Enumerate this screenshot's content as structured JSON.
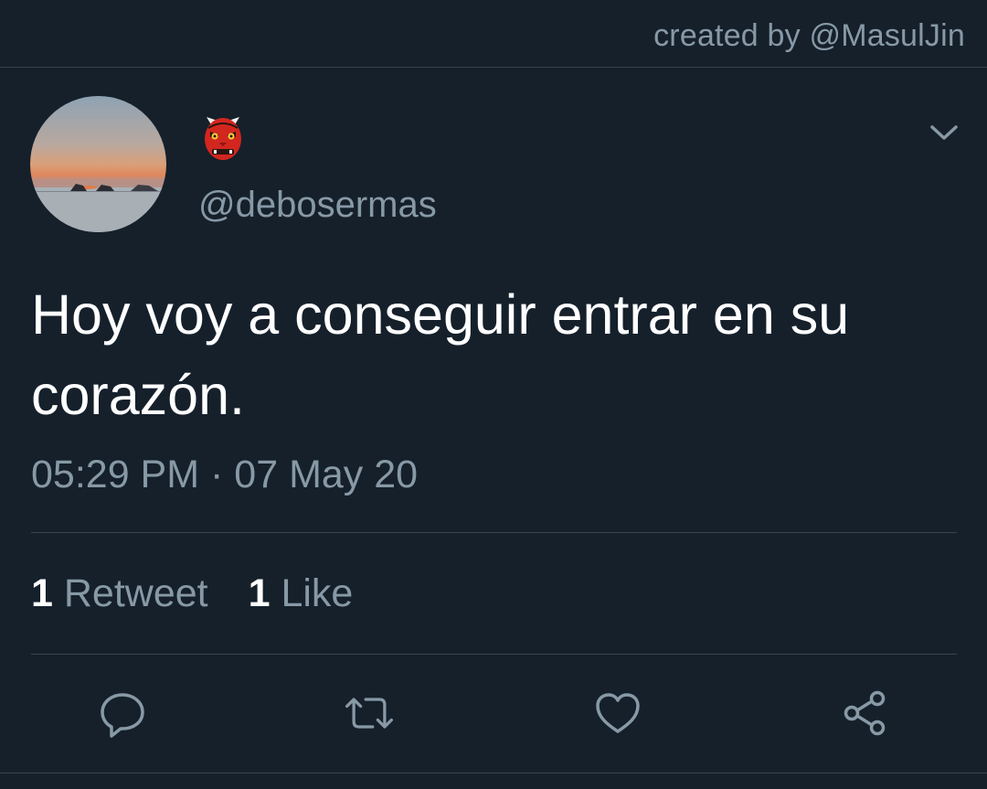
{
  "header": {
    "credit": "created by @MasulJin"
  },
  "tweet": {
    "display_name_icon": "red-oni-mask-emoji",
    "handle": "@debosermas",
    "text": "Hoy voy a conseguir entrar en su corazón.",
    "time": "05:29 PM",
    "separator": "·",
    "date": "07 May 20"
  },
  "stats": {
    "retweets_count": "1",
    "retweets_label": "Retweet",
    "likes_count": "1",
    "likes_label": "Like"
  },
  "actions": {
    "icons": [
      "reply-icon",
      "retweet-icon",
      "like-icon",
      "share-icon"
    ]
  },
  "colors": {
    "background": "#15202b",
    "secondary_text": "#8899a6",
    "divider": "#38444d",
    "primary_text": "#ffffff"
  }
}
